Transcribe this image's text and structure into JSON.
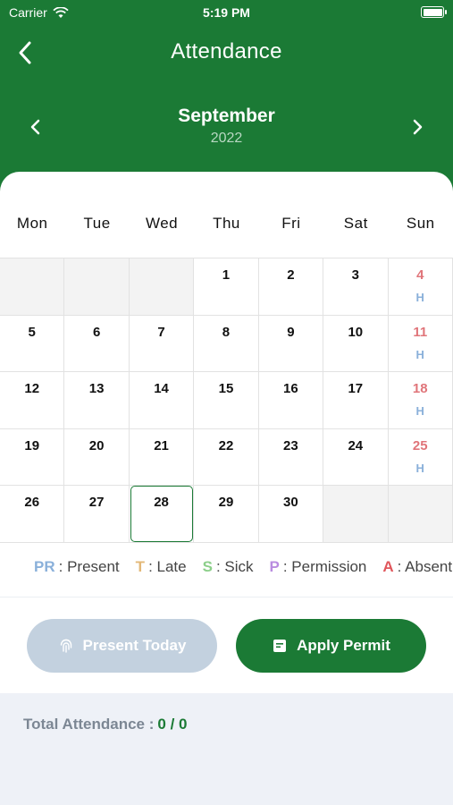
{
  "status_bar": {
    "carrier": "Carrier",
    "time": "5:19 PM"
  },
  "header": {
    "title": "Attendance"
  },
  "calendar": {
    "month": "September",
    "year": "2022",
    "weekdays": [
      "Mon",
      "Tue",
      "Wed",
      "Thu",
      "Fri",
      "Sat",
      "Sun"
    ],
    "rows": [
      [
        {
          "d": ""
        },
        {
          "d": ""
        },
        {
          "d": ""
        },
        {
          "d": "1"
        },
        {
          "d": "2"
        },
        {
          "d": "3"
        },
        {
          "d": "4",
          "tag": "H"
        }
      ],
      [
        {
          "d": "5"
        },
        {
          "d": "6"
        },
        {
          "d": "7"
        },
        {
          "d": "8"
        },
        {
          "d": "9"
        },
        {
          "d": "10"
        },
        {
          "d": "11",
          "tag": "H"
        }
      ],
      [
        {
          "d": "12"
        },
        {
          "d": "13"
        },
        {
          "d": "14"
        },
        {
          "d": "15"
        },
        {
          "d": "16"
        },
        {
          "d": "17"
        },
        {
          "d": "18",
          "tag": "H"
        }
      ],
      [
        {
          "d": "19"
        },
        {
          "d": "20"
        },
        {
          "d": "21"
        },
        {
          "d": "22"
        },
        {
          "d": "23"
        },
        {
          "d": "24"
        },
        {
          "d": "25",
          "tag": "H"
        }
      ],
      [
        {
          "d": "26"
        },
        {
          "d": "27"
        },
        {
          "d": "28",
          "today": true
        },
        {
          "d": "29"
        },
        {
          "d": "30"
        },
        {
          "d": ""
        },
        {
          "d": ""
        }
      ]
    ]
  },
  "legend": [
    {
      "code": "PR",
      "label": ": Present",
      "color": "#8ab0da"
    },
    {
      "code": "T",
      "label": ": Late",
      "color": "#e3b878"
    },
    {
      "code": "S",
      "label": ": Sick",
      "color": "#8ccf8a"
    },
    {
      "code": "P",
      "label": ": Permission",
      "color": "#b98ce0"
    },
    {
      "code": "A",
      "label": ": Absent",
      "color": "#e0575c"
    }
  ],
  "actions": {
    "present_label": "Present Today",
    "permit_label": "Apply Permit"
  },
  "summary": {
    "label": "Total Attendance :",
    "value": "0 / 0"
  },
  "colors": {
    "primary": "#1b7a35",
    "holiday": "#e0757a",
    "holiday_tag": "#8ab0da"
  }
}
